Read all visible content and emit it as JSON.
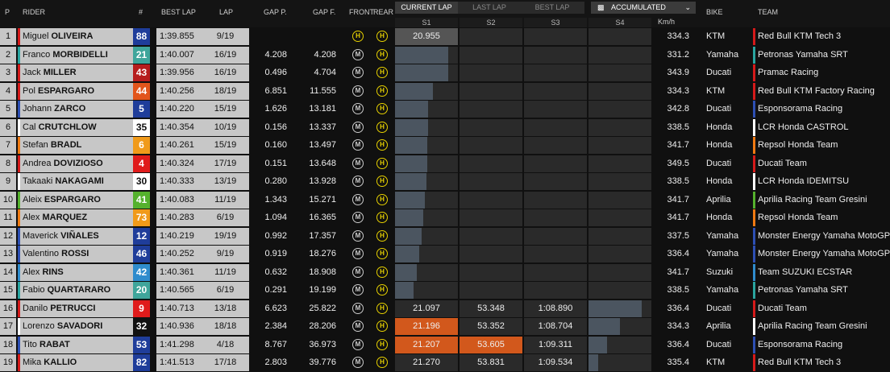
{
  "header": {
    "p": "P",
    "rider": "RIDER",
    "num": "#",
    "best": "BEST LAP",
    "lap": "LAP",
    "gapp": "GAP P.",
    "gapf": "GAP F.",
    "front": "FRONT",
    "rear": "REAR",
    "kmh": "Km/h",
    "bike": "BIKE",
    "team": "TEAM",
    "tabs": [
      "CURRENT LAP",
      "LAST LAP",
      "BEST LAP"
    ],
    "dropdown": "ACCUMULATED",
    "sectors": [
      "S1",
      "S2",
      "S3",
      "S4"
    ]
  },
  "rows": [
    {
      "p": "1",
      "first": "Miguel",
      "last": "OLIVEIRA",
      "num": "88",
      "numbg": "#1f3d9a",
      "numfg": "#fff",
      "best": "1:39.855",
      "lap": "9/19",
      "gp": "",
      "gf": "",
      "front": "H",
      "rear": "H",
      "s1": "20.955",
      "s1bg": "grey",
      "s2": "",
      "s3": "",
      "s4": "",
      "s1bar": 0,
      "s2bar": 0,
      "s3bar": 0,
      "s4bar": 0,
      "kmh": "334.3",
      "bike": "KTM",
      "team": "Red Bull KTM Tech 3",
      "tc": "#d51a1a"
    },
    {
      "p": "2",
      "first": "Franco",
      "last": "MORBIDELLI",
      "num": "21",
      "numbg": "#3fa59b",
      "numfg": "#fff",
      "best": "1:40.007",
      "lap": "16/19",
      "gp": "4.208",
      "gf": "4.208",
      "front": "M",
      "rear": "H",
      "s1": "",
      "s2": "",
      "s3": "",
      "s4": "",
      "s1bar": 0.85,
      "s2bar": 0,
      "s3bar": 0,
      "s4bar": 0,
      "kmh": "331.2",
      "bike": "Yamaha",
      "team": "Petronas Yamaha SRT",
      "tc": "#2aa5a0"
    },
    {
      "p": "3",
      "first": "Jack",
      "last": "MILLER",
      "num": "43",
      "numbg": "#b61d1d",
      "numfg": "#fff",
      "best": "1:39.956",
      "lap": "16/19",
      "gp": "0.496",
      "gf": "4.704",
      "front": "M",
      "rear": "H",
      "s1": "",
      "s2": "",
      "s3": "",
      "s4": "",
      "s1bar": 0.84,
      "s2bar": 0,
      "s3bar": 0,
      "s4bar": 0,
      "kmh": "343.9",
      "bike": "Ducati",
      "team": "Pramac Racing",
      "tc": "#d51a1a"
    },
    {
      "p": "4",
      "first": "Pol",
      "last": "ESPARGARO",
      "num": "44",
      "numbg": "#e2551b",
      "numfg": "#fff",
      "best": "1:40.256",
      "lap": "18/19",
      "gp": "6.851",
      "gf": "11.555",
      "front": "M",
      "rear": "H",
      "s1": "",
      "s2": "",
      "s3": "",
      "s4": "",
      "s1bar": 0.6,
      "s2bar": 0,
      "s3bar": 0,
      "s4bar": 0,
      "kmh": "334.3",
      "bike": "KTM",
      "team": "Red Bull KTM Factory Racing",
      "tc": "#d51a1a"
    },
    {
      "p": "5",
      "first": "Johann",
      "last": "ZARCO",
      "num": "5",
      "numbg": "#1f3d9a",
      "numfg": "#fff",
      "best": "1:40.220",
      "lap": "15/19",
      "gp": "1.626",
      "gf": "13.181",
      "front": "M",
      "rear": "H",
      "s1": "",
      "s2": "",
      "s3": "",
      "s4": "",
      "s1bar": 0.53,
      "s2bar": 0,
      "s3bar": 0,
      "s4bar": 0,
      "kmh": "342.8",
      "bike": "Ducati",
      "team": "Esponsorama Racing",
      "tc": "#2d4fb3"
    },
    {
      "p": "6",
      "first": "Cal",
      "last": "CRUTCHLOW",
      "num": "35",
      "numbg": "#ffffff",
      "numfg": "#111",
      "best": "1:40.354",
      "lap": "10/19",
      "gp": "0.156",
      "gf": "13.337",
      "front": "M",
      "rear": "H",
      "s1": "",
      "s2": "",
      "s3": "",
      "s4": "",
      "s1bar": 0.52,
      "s2bar": 0,
      "s3bar": 0,
      "s4bar": 0,
      "kmh": "338.5",
      "bike": "Honda",
      "team": "LCR Honda CASTROL",
      "tc": "#ffffff"
    },
    {
      "p": "7",
      "first": "Stefan",
      "last": "BRADL",
      "num": "6",
      "numbg": "#f09a1a",
      "numfg": "#fff",
      "best": "1:40.261",
      "lap": "15/19",
      "gp": "0.160",
      "gf": "13.497",
      "front": "M",
      "rear": "H",
      "s1": "",
      "s2": "",
      "s3": "",
      "s4": "",
      "s1bar": 0.51,
      "s2bar": 0,
      "s3bar": 0,
      "s4bar": 0,
      "kmh": "341.7",
      "bike": "Honda",
      "team": "Repsol Honda Team",
      "tc": "#f07a12"
    },
    {
      "p": "8",
      "first": "Andrea",
      "last": "DOVIZIOSO",
      "num": "4",
      "numbg": "#e01b1b",
      "numfg": "#fff",
      "best": "1:40.324",
      "lap": "17/19",
      "gp": "0.151",
      "gf": "13.648",
      "front": "M",
      "rear": "H",
      "s1": "",
      "s2": "",
      "s3": "",
      "s4": "",
      "s1bar": 0.51,
      "s2bar": 0,
      "s3bar": 0,
      "s4bar": 0,
      "kmh": "349.5",
      "bike": "Ducati",
      "team": "Ducati Team",
      "tc": "#d51a1a"
    },
    {
      "p": "9",
      "first": "Takaaki",
      "last": "NAKAGAMI",
      "num": "30",
      "numbg": "#ffffff",
      "numfg": "#111",
      "best": "1:40.333",
      "lap": "13/19",
      "gp": "0.280",
      "gf": "13.928",
      "front": "M",
      "rear": "H",
      "s1": "",
      "s2": "",
      "s3": "",
      "s4": "",
      "s1bar": 0.5,
      "s2bar": 0,
      "s3bar": 0,
      "s4bar": 0,
      "kmh": "338.5",
      "bike": "Honda",
      "team": "LCR Honda IDEMITSU",
      "tc": "#ffffff"
    },
    {
      "p": "10",
      "first": "Aleix",
      "last": "ESPARGARO",
      "num": "41",
      "numbg": "#55b12d",
      "numfg": "#fff",
      "best": "1:40.083",
      "lap": "11/19",
      "gp": "1.343",
      "gf": "15.271",
      "front": "M",
      "rear": "H",
      "s1": "",
      "s2": "",
      "s3": "",
      "s4": "",
      "s1bar": 0.48,
      "s2bar": 0,
      "s3bar": 0,
      "s4bar": 0,
      "kmh": "341.7",
      "bike": "Aprilia",
      "team": "Aprilia Racing Team Gresini",
      "tc": "#55b12d"
    },
    {
      "p": "11",
      "first": "Alex",
      "last": "MARQUEZ",
      "num": "73",
      "numbg": "#f09a1a",
      "numfg": "#fff",
      "best": "1:40.283",
      "lap": "6/19",
      "gp": "1.094",
      "gf": "16.365",
      "front": "M",
      "rear": "H",
      "s1": "",
      "s2": "",
      "s3": "",
      "s4": "",
      "s1bar": 0.45,
      "s2bar": 0,
      "s3bar": 0,
      "s4bar": 0,
      "kmh": "341.7",
      "bike": "Honda",
      "team": "Repsol Honda Team",
      "tc": "#f07a12"
    },
    {
      "p": "12",
      "first": "Maverick",
      "last": "VIÑALES",
      "num": "12",
      "numbg": "#1f3d9a",
      "numfg": "#fff",
      "best": "1:40.219",
      "lap": "19/19",
      "gp": "0.992",
      "gf": "17.357",
      "front": "M",
      "rear": "H",
      "s1": "",
      "s2": "",
      "s3": "",
      "s4": "",
      "s1bar": 0.42,
      "s2bar": 0,
      "s3bar": 0,
      "s4bar": 0,
      "kmh": "337.5",
      "bike": "Yamaha",
      "team": "Monster Energy Yamaha MotoGP",
      "tc": "#2d4fb3"
    },
    {
      "p": "13",
      "first": "Valentino",
      "last": "ROSSI",
      "num": "46",
      "numbg": "#1f3d9a",
      "numfg": "#fff",
      "best": "1:40.252",
      "lap": "9/19",
      "gp": "0.919",
      "gf": "18.276",
      "front": "M",
      "rear": "H",
      "s1": "",
      "s2": "",
      "s3": "",
      "s4": "",
      "s1bar": 0.38,
      "s2bar": 0,
      "s3bar": 0,
      "s4bar": 0,
      "kmh": "336.4",
      "bike": "Yamaha",
      "team": "Monster Energy Yamaha MotoGP",
      "tc": "#2d4fb3"
    },
    {
      "p": "14",
      "first": "Alex",
      "last": "RINS",
      "num": "42",
      "numbg": "#2f8ccd",
      "numfg": "#fff",
      "best": "1:40.361",
      "lap": "11/19",
      "gp": "0.632",
      "gf": "18.908",
      "front": "M",
      "rear": "H",
      "s1": "",
      "s2": "",
      "s3": "",
      "s4": "",
      "s1bar": 0.35,
      "s2bar": 0,
      "s3bar": 0,
      "s4bar": 0,
      "kmh": "341.7",
      "bike": "Suzuki",
      "team": "Team SUZUKI ECSTAR",
      "tc": "#2f8ccd"
    },
    {
      "p": "15",
      "first": "Fabio",
      "last": "QUARTARARO",
      "num": "20",
      "numbg": "#3fa59b",
      "numfg": "#fff",
      "best": "1:40.565",
      "lap": "6/19",
      "gp": "0.291",
      "gf": "19.199",
      "front": "M",
      "rear": "H",
      "s1": "",
      "s2": "",
      "s3": "",
      "s4": "",
      "s1bar": 0.3,
      "s2bar": 0,
      "s3bar": 0,
      "s4bar": 0,
      "kmh": "338.5",
      "bike": "Yamaha",
      "team": "Petronas Yamaha SRT",
      "tc": "#2aa5a0"
    },
    {
      "p": "16",
      "first": "Danilo",
      "last": "PETRUCCI",
      "num": "9",
      "numbg": "#e01b1b",
      "numfg": "#fff",
      "best": "1:40.713",
      "lap": "13/18",
      "gp": "6.623",
      "gf": "25.822",
      "front": "M",
      "rear": "H",
      "s1": "21.097",
      "s2": "53.348",
      "s3": "1:08.890",
      "s4": "",
      "s1bg": "dark",
      "s1bar": 0,
      "s2bar": 0,
      "s3bar": 0,
      "s4bar": 0.85,
      "kmh": "336.4",
      "bike": "Ducati",
      "team": "Ducati Team",
      "tc": "#d51a1a"
    },
    {
      "p": "17",
      "first": "Lorenzo",
      "last": "SAVADORI",
      "num": "32",
      "numbg": "#111111",
      "numfg": "#fff",
      "best": "1:40.936",
      "lap": "18/18",
      "gp": "2.384",
      "gf": "28.206",
      "front": "M",
      "rear": "H",
      "s1": "21.196",
      "s2": "53.352",
      "s3": "1:08.704",
      "s4": "",
      "s1bg": "orange",
      "s1bar": 0,
      "s2bar": 0,
      "s3bar": 0,
      "s4bar": 0.5,
      "kmh": "334.3",
      "bike": "Aprilia",
      "team": "Aprilia Racing Team Gresini",
      "tc": "#ffffff"
    },
    {
      "p": "18",
      "first": "Tito",
      "last": "RABAT",
      "num": "53",
      "numbg": "#1f3d9a",
      "numfg": "#fff",
      "best": "1:41.298",
      "lap": "4/18",
      "gp": "8.767",
      "gf": "36.973",
      "front": "M",
      "rear": "H",
      "s1": "21.207",
      "s2": "53.605",
      "s3": "1:09.311",
      "s4": "",
      "s1bg": "orange",
      "s2bg": "orange",
      "s1bar": 0,
      "s2bar": 0,
      "s3bar": 0,
      "s4bar": 0.3,
      "kmh": "336.4",
      "bike": "Ducati",
      "team": "Esponsorama Racing",
      "tc": "#2d4fb3"
    },
    {
      "p": "19",
      "first": "Mika",
      "last": "KALLIO",
      "num": "82",
      "numbg": "#1f3d9a",
      "numfg": "#fff",
      "best": "1:41.513",
      "lap": "17/18",
      "gp": "2.803",
      "gf": "39.776",
      "front": "M",
      "rear": "H",
      "s1": "21.270",
      "s2": "53.831",
      "s3": "1:09.534",
      "s4": "",
      "s1bg": "dark",
      "s1bar": 0,
      "s2bar": 0,
      "s3bar": 0,
      "s4bar": 0.15,
      "kmh": "335.4",
      "bike": "KTM",
      "team": "Red Bull KTM Tech 3",
      "tc": "#d51a1a"
    }
  ]
}
